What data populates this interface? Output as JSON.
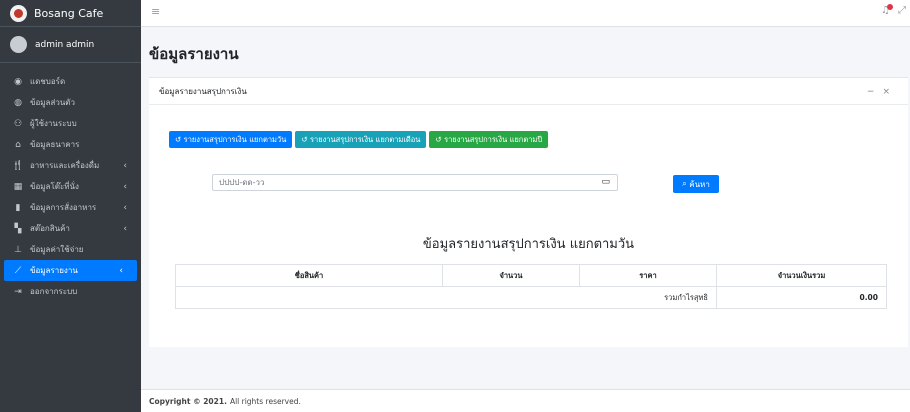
{
  "sidebar": {
    "brand": "Bosang Cafe",
    "user": "admin admin",
    "items": [
      {
        "icon": "tachometer-icon",
        "glyph": "◉",
        "label": "แดชบอร์ด",
        "chevron": ""
      },
      {
        "icon": "user-icon",
        "glyph": "◍",
        "label": "ข้อมูลส่วนตัว",
        "chevron": ""
      },
      {
        "icon": "users-icon",
        "glyph": "⚇",
        "label": "ผู้ใช้งานระบบ",
        "chevron": ""
      },
      {
        "icon": "bank-icon",
        "glyph": "⌂",
        "label": "ข้อมูลธนาคาร",
        "chevron": ""
      },
      {
        "icon": "utensils-icon",
        "glyph": "🍴",
        "label": "อาหารและเครื่องดื่ม",
        "chevron": "‹"
      },
      {
        "icon": "table-icon",
        "glyph": "▦",
        "label": "ข้อมูลโต๊ะที่นั่ง",
        "chevron": "‹"
      },
      {
        "icon": "clipboard-icon",
        "glyph": "▮",
        "label": "ข้อมูลการสั่งอาหาร",
        "chevron": "‹"
      },
      {
        "icon": "cubes-icon",
        "glyph": "▚",
        "label": "สต๊อกสินค้า",
        "chevron": "‹"
      },
      {
        "icon": "money-icon",
        "glyph": "⊥",
        "label": "ข้อมูลค่าใช้จ่าย",
        "chevron": ""
      },
      {
        "icon": "chart-icon",
        "glyph": "⟋",
        "label": "ข้อมูลรายงาน",
        "chevron": "‹",
        "active": true
      },
      {
        "icon": "sign-out-icon",
        "glyph": "⇥",
        "label": "ออกจากระบบ",
        "chevron": ""
      }
    ]
  },
  "page": {
    "title": "ข้อมูลรายงาน",
    "card_title": "ข้อมูลรายงานสรุปการเงิน",
    "buttons": {
      "daily": "รายงานสรุปการเงิน แยกตามวัน",
      "monthly": "รายงานสรุปการเงิน แยกตามเดือน",
      "yearly": "รายงานสรุปการเงิน แยกตามปี"
    },
    "date_placeholder": "ปปปป-ดด-วว",
    "search_label": "ค้นหา",
    "report_title": "ข้อมูลรายงานสรุปการเงิน แยกตามวัน",
    "table": {
      "headers": [
        "ชื่อสินค้า",
        "จำนวน",
        "ราคา",
        "จำนวนเงินรวม"
      ],
      "summary_label": "รวมกำไรสุทธิ",
      "summary_value": "0.00"
    }
  },
  "footer": {
    "copyright": "Copyright © 2021.",
    "rights": "All rights reserved."
  }
}
